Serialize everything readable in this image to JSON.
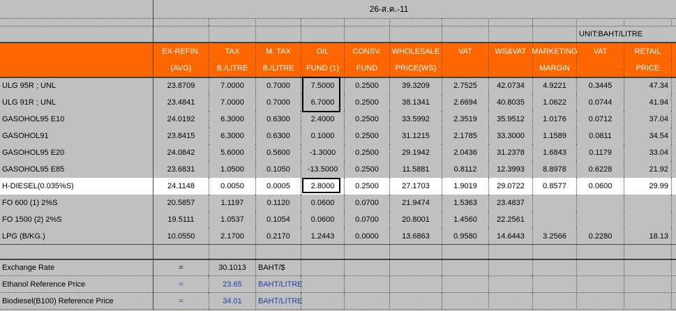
{
  "date": "26-ส.ค.-11",
  "unit": "UNIT:BAHT/LITRE",
  "headers": {
    "row1": [
      "EX-REFIN.",
      "TAX",
      "M. TAX",
      "OIL",
      "CONSV.",
      "WHOLESALE",
      "VAT",
      "WS&VAT",
      "MARKETING",
      "VAT",
      "RETAIL"
    ],
    "row2": [
      "(AVG)",
      "B./LITRE",
      "B./LITRE",
      "FUND (1)",
      "FUND",
      "PRICE(WS)",
      "",
      "",
      "MARGIN",
      "",
      "PRICE"
    ]
  },
  "products": [
    {
      "name": "ULG 95R ; UNL",
      "values": [
        "23.8709",
        "7.0000",
        "0.7000",
        "7.5000",
        "0.2500",
        "39.3209",
        "2.7525",
        "42.0734",
        "4.9221",
        "0.3445",
        "47.34"
      ]
    },
    {
      "name": "ULG 91R ; UNL",
      "values": [
        "23.4841",
        "7.0000",
        "0.7000",
        "6.7000",
        "0.2500",
        "38.1341",
        "2.6694",
        "40.8035",
        "1.0622",
        "0.0744",
        "41.94"
      ]
    },
    {
      "name": "GASOHOL95 E10",
      "values": [
        "24.0192",
        "6.3000",
        "0.6300",
        "2.4000",
        "0.2500",
        "33.5992",
        "2.3519",
        "35.9512",
        "1.0176",
        "0.0712",
        "37.04"
      ]
    },
    {
      "name": "GASOHOL91",
      "values": [
        "23.8415",
        "6.3000",
        "0.6300",
        "0.1000",
        "0.2500",
        "31.1215",
        "2.1785",
        "33.3000",
        "1.1589",
        "0.0811",
        "34.54"
      ]
    },
    {
      "name": "GASOHOL95 E20",
      "values": [
        "24.0842",
        "5.6000",
        "0.5600",
        "-1.3000",
        "0.2500",
        "29.1942",
        "2.0436",
        "31.2378",
        "1.6843",
        "0.1179",
        "33.04"
      ]
    },
    {
      "name": "GASOHOL95 E85",
      "values": [
        "23.6831",
        "1.0500",
        "0.1050",
        "-13.5000",
        "0.2500",
        "11.5881",
        "0.8112",
        "12.3993",
        "8.8978",
        "0.6228",
        "21.92"
      ]
    },
    {
      "name": "H-DIESEL(0.035%S)",
      "values": [
        "24.1148",
        "0.0050",
        "0.0005",
        "2.8000",
        "0.2500",
        "27.1703",
        "1.9019",
        "29.0722",
        "0.8577",
        "0.0600",
        "29.99"
      ]
    },
    {
      "name": "FO 600 (1) 2%S",
      "values": [
        "20.5857",
        "1.1197",
        "0.1120",
        "0.0600",
        "0.0700",
        "21.9474",
        "1.5363",
        "23.4837",
        "",
        "",
        ""
      ]
    },
    {
      "name": "FO 1500 (2) 2%S",
      "values": [
        "19.5111",
        "1.0537",
        "0.1054",
        "0.0600",
        "0.0700",
        "20.8001",
        "1.4560",
        "22.2561",
        "",
        "",
        ""
      ]
    },
    {
      "name": "LPG (B/KG.)",
      "values": [
        "10.0550",
        "2.1700",
        "0.2170",
        "1.2443",
        "0.0000",
        "13.6863",
        "0.9580",
        "14.6443",
        "3.2566",
        "0.2280",
        "18.13"
      ]
    }
  ],
  "footer": [
    {
      "label": "Exchange Rate",
      "eq": "=",
      "value": "30.1013",
      "unit": "BAHT/$"
    },
    {
      "label": "Ethanol Reference Price",
      "eq": "=",
      "value": "23.65",
      "unit": "BAHT/LITRE"
    },
    {
      "label": "Biodiesel(B100) Reference Price",
      "eq": "=",
      "value": "34.01",
      "unit": "BAHT/LITRE"
    }
  ]
}
